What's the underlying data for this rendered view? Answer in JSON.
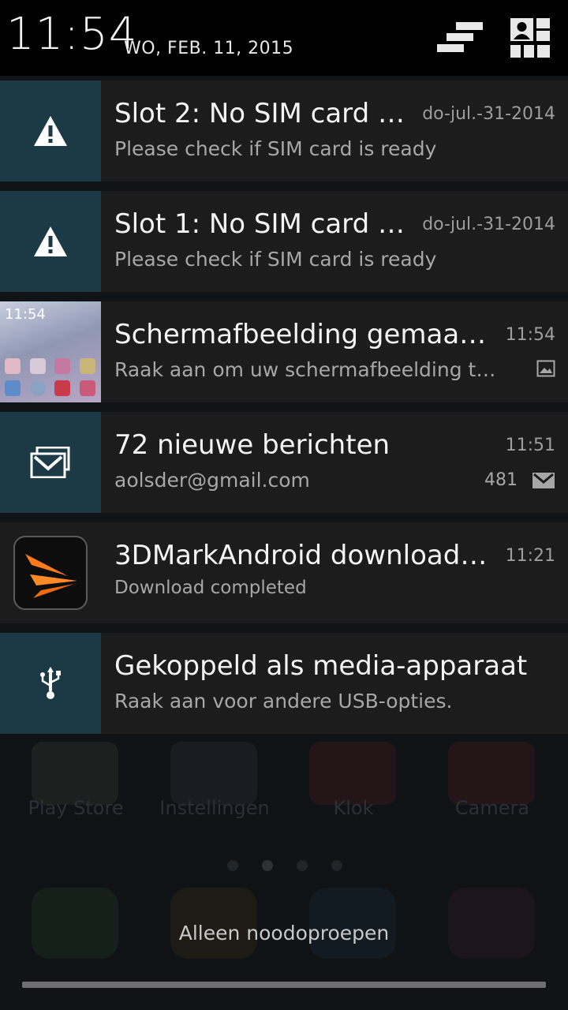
{
  "status": {
    "time": "11:54",
    "date": "WO, FEB. 11, 2015"
  },
  "notifications": [
    {
      "title": "Slot 2: No SIM card de…",
      "text": "Please check if SIM card is ready",
      "time": "do-jul.-31-2014",
      "icon": "warning-icon"
    },
    {
      "title": "Slot 1: No SIM card de…",
      "text": "Please check if SIM card is ready",
      "time": "do-jul.-31-2014",
      "icon": "warning-icon"
    },
    {
      "title": "Schermafbeelding gemaakt.",
      "text": "Raak aan om uw schermafbeelding te…",
      "time": "11:54",
      "icon": "screenshot-thumbnail",
      "thumb_time": "11:54"
    },
    {
      "title": "72 nieuwe berichten",
      "text": "aolsder@gmail.com",
      "time": "11:51",
      "count": "481",
      "icon": "gmail-icon"
    },
    {
      "title": "3DMarkAndroid download co…",
      "text": "Download completed",
      "time": "11:21",
      "icon": "3dmark-app-icon"
    },
    {
      "title": "Gekoppeld als media-apparaat",
      "text": "Raak aan voor andere USB-opties.",
      "time": "",
      "icon": "usb-icon"
    }
  ],
  "background_apps": [
    "Play Store",
    "Instellingen",
    "Klok",
    "Camera"
  ],
  "emergency_label": "Alleen noodoproepen",
  "colors": {
    "icon_panel": "#1b3a45",
    "card_bg": "#1c1c1c",
    "header_bg": "#000000",
    "accent_orange": "#ff7a1a"
  }
}
